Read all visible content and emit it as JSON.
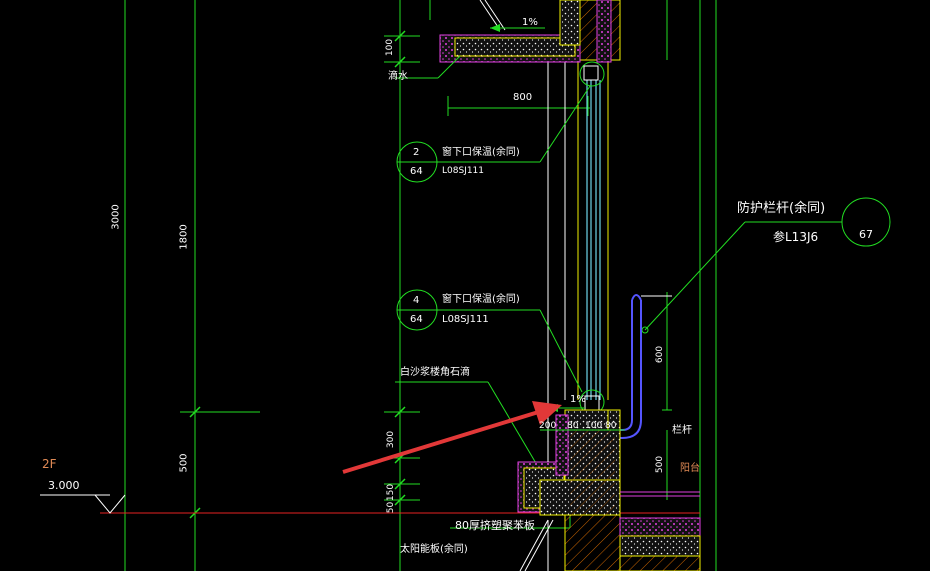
{
  "drawing": {
    "dims": {
      "d100": "100",
      "d800": "800",
      "d3000": "3000",
      "d1800": "1800",
      "d600": "600",
      "d300": "300",
      "d500a": "500",
      "d150": "150",
      "d50": "50",
      "d500b": "500",
      "d200": "200",
      "d80a": "80",
      "d100b": "100",
      "d80b": "80"
    },
    "slope_top": "1%",
    "slope_bottom": "1%",
    "drip_label": "滴水",
    "level": {
      "floor": "2F",
      "elevation": "3.000"
    },
    "callout_railing": {
      "title": "防护栏杆(余同)",
      "ref": "参L13J6",
      "num": "67"
    },
    "callout_2": {
      "num": "2",
      "page": "64",
      "text": "窗下口保温(余同)",
      "ref": "L08SJ111"
    },
    "callout_4": {
      "num": "4",
      "page": "64",
      "text": "窗下口保温(余同)",
      "ref": "L08SJ111"
    },
    "note_sill": "白沙浆楼角石滴",
    "note_plate": "80厚挤塑聚苯板",
    "note_solar": "太阳能板(余同)",
    "note_rail": "栏杆",
    "note_balcony": "阳台"
  },
  "colors": {
    "green": "#22dd22",
    "yellow": "#f0f000",
    "white": "#ffffff",
    "cyan": "#6fd5e8",
    "magenta": "#e040e0",
    "red": "#e62222",
    "orange": "#e08a55",
    "arrow": "#e23838"
  }
}
